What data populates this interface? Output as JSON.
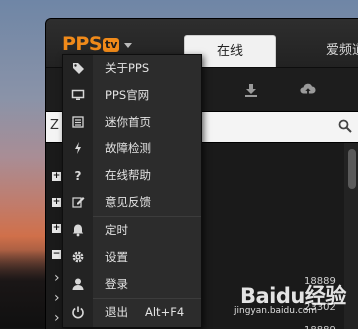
{
  "header": {
    "logo_text": "PPS",
    "logo_badge": "tv",
    "tabs": [
      {
        "label": "在线",
        "active": true
      },
      {
        "label": "爱频道",
        "active": false
      }
    ]
  },
  "search": {
    "visible_text": "Z"
  },
  "list": {
    "counts": [
      "18889",
      "23302",
      "18889"
    ]
  },
  "menu": {
    "items": [
      {
        "label": "关于PPS",
        "icon": "tag-icon"
      },
      {
        "label": "PPS官网",
        "icon": "monitor-icon"
      },
      {
        "label": "迷你首页",
        "icon": "list-icon"
      },
      {
        "label": "故障检测",
        "icon": "bolt-icon"
      },
      {
        "label": "在线帮助",
        "icon": "question-icon"
      },
      {
        "label": "意见反馈",
        "icon": "edit-icon"
      },
      {
        "label": "定时",
        "icon": "bell-icon"
      },
      {
        "label": "设置",
        "icon": "gear-icon"
      },
      {
        "label": "登录",
        "icon": "user-icon"
      },
      {
        "label": "退出",
        "icon": "power-icon",
        "shortcut": "Alt+F4"
      }
    ]
  },
  "watermark": {
    "brand": "Baidu经验",
    "url": "jingyan.baidu.com"
  },
  "colors": {
    "accent": "#f08a1a",
    "menu_bg": "#2c2c2c",
    "window_bg": "#1b1b1b"
  }
}
